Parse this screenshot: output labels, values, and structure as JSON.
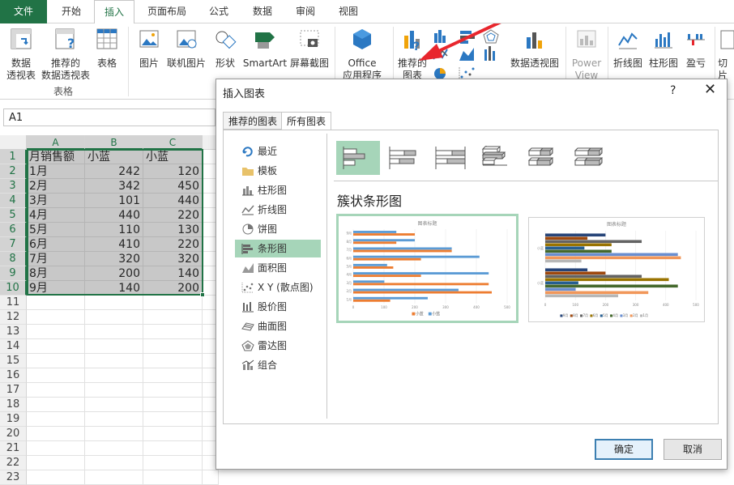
{
  "ribbon_tabs": [
    "文件",
    "开始",
    "插入",
    "页面布局",
    "公式",
    "数据",
    "审阅",
    "视图"
  ],
  "ribbon": {
    "pivot_table": "数据\n透视表",
    "recommended_pivot": "推荐的\n数据透视表",
    "table": "表格",
    "group_tables": "表格",
    "pictures": "图片",
    "online_pictures": "联机图片",
    "shapes": "形状",
    "smartart": "SmartArt",
    "screenshot": "屏幕截图",
    "office_apps": "Office\n应用程序",
    "recommended_charts": "推荐的\n图表",
    "pivot_chart": "数据透视图",
    "power_view": "Power\nView",
    "sparkline_line": "折线图",
    "sparkline_column": "柱形图",
    "sparkline_winloss": "盈亏",
    "slicer": "切片"
  },
  "name_box": "A1",
  "sheet": {
    "columns": [
      "A",
      "B",
      "C"
    ],
    "rows": [
      [
        "月销售额",
        "小蓝",
        "小蓝"
      ],
      [
        "1月",
        "242",
        "120"
      ],
      [
        "2月",
        "342",
        "450"
      ],
      [
        "3月",
        "101",
        "440"
      ],
      [
        "4月",
        "440",
        "220"
      ],
      [
        "5月",
        "110",
        "130"
      ],
      [
        "6月",
        "410",
        "220"
      ],
      [
        "7月",
        "320",
        "320"
      ],
      [
        "8月",
        "200",
        "140"
      ],
      [
        "9月",
        "140",
        "200"
      ]
    ],
    "row_numbers": [
      "1",
      "2",
      "3",
      "4",
      "5",
      "6",
      "7",
      "8",
      "9",
      "10",
      "11",
      "12",
      "13",
      "14",
      "15",
      "16",
      "17",
      "18",
      "19",
      "20",
      "21",
      "22",
      "23"
    ]
  },
  "dialog": {
    "title": "插入图表",
    "help": "?",
    "close": "✕",
    "tabs": [
      "推荐的图表",
      "所有图表"
    ],
    "active_tab": 1,
    "categories": [
      "最近",
      "模板",
      "柱形图",
      "折线图",
      "饼图",
      "条形图",
      "面积图",
      "X Y (散点图)",
      "股价图",
      "曲面图",
      "雷达图",
      "组合"
    ],
    "active_category": 5,
    "subtype_title": "簇状条形图",
    "ok": "确定",
    "cancel": "取消",
    "preview1": {
      "title": "图表标题",
      "categories": [
        "9月",
        "8月",
        "7月",
        "6月",
        "5月",
        "4月",
        "3月",
        "2月",
        "1月"
      ],
      "series_a": [
        140,
        200,
        320,
        410,
        110,
        440,
        101,
        342,
        242
      ],
      "series_b": [
        200,
        140,
        320,
        220,
        130,
        220,
        440,
        450,
        120
      ],
      "axis": [
        "0",
        "100",
        "200",
        "300",
        "400",
        "500"
      ],
      "legend": [
        "小蓝",
        "小蓝"
      ]
    },
    "preview2": {
      "title": "图表标题",
      "axis": [
        "0",
        "100",
        "200",
        "300",
        "400",
        "500"
      ],
      "group_labels": [
        "小蓝",
        "小蓝"
      ],
      "legend": [
        "9月",
        "8月",
        "7月",
        "6月",
        "5月",
        "4月",
        "3月",
        "2月",
        "1月"
      ]
    }
  },
  "colors": {
    "excel_green": "#217346",
    "selection_green": "#a6d5b9",
    "series_blue": "#5b9bd5",
    "series_orange": "#ed7d31",
    "arrow_red": "#e8262d"
  }
}
